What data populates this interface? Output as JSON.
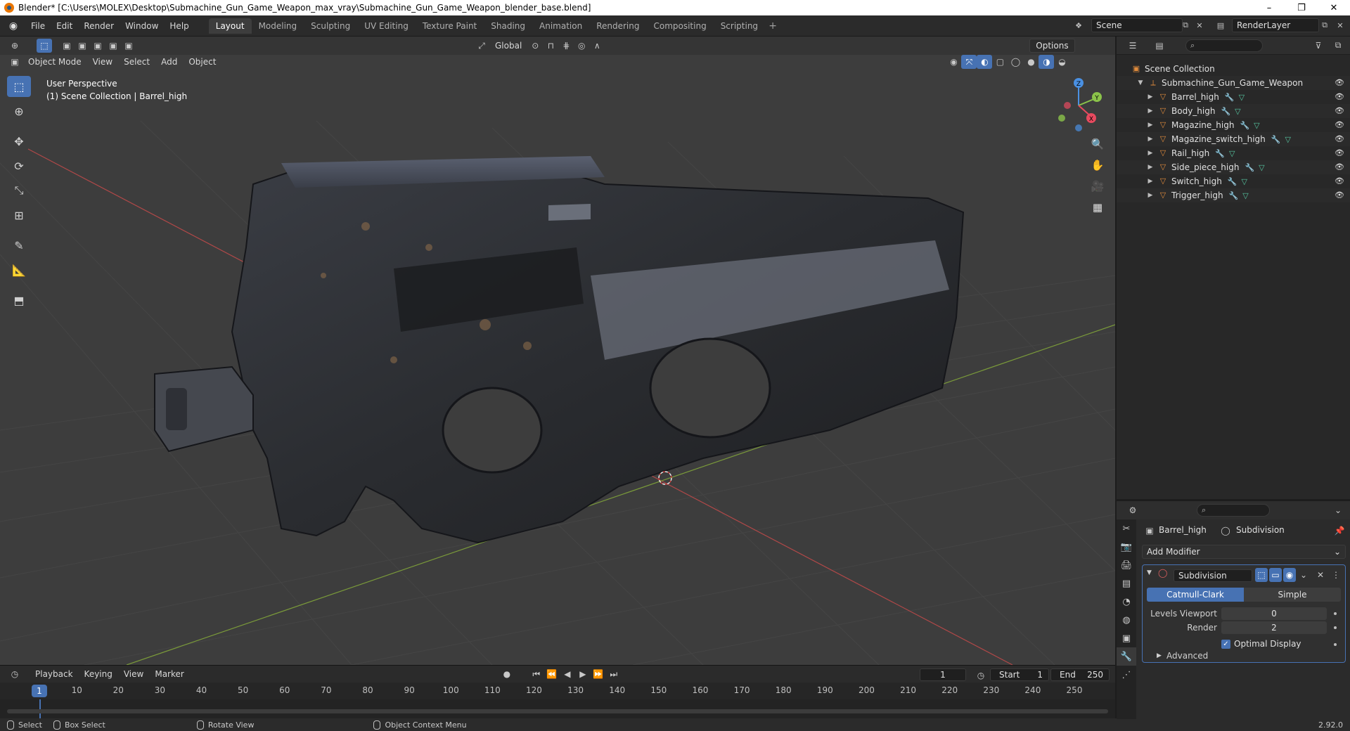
{
  "window": {
    "title": "Blender* [C:\\Users\\MOLEX\\Desktop\\Submachine_Gun_Game_Weapon_max_vray\\Submachine_Gun_Game_Weapon_blender_base.blend]",
    "minimize": "–",
    "maximize": "❐",
    "close": "✕"
  },
  "menu": [
    "File",
    "Edit",
    "Render",
    "Window",
    "Help"
  ],
  "workspaces": [
    "Layout",
    "Modeling",
    "Sculpting",
    "UV Editing",
    "Texture Paint",
    "Shading",
    "Animation",
    "Rendering",
    "Compositing",
    "Scripting"
  ],
  "active_workspace": "Layout",
  "scene_name": "Scene",
  "view_layer": "RenderLayer",
  "viewport": {
    "mode": "Object Mode",
    "menus": [
      "View",
      "Select",
      "Add",
      "Object"
    ],
    "transform_orientation": "Global",
    "options_label": "Options",
    "info_line1": "User Perspective",
    "info_line2": "(1) Scene Collection | Barrel_high",
    "gizmo_axes": [
      "Z",
      "Y",
      "X"
    ]
  },
  "timeline": {
    "menus": [
      "Playback",
      "Keying",
      "View",
      "Marker"
    ],
    "current_frame": "1",
    "start_label": "Start",
    "start": "1",
    "end_label": "End",
    "end": "250",
    "ruler": [
      "1",
      "10",
      "20",
      "30",
      "40",
      "50",
      "60",
      "70",
      "80",
      "90",
      "100",
      "110",
      "120",
      "130",
      "140",
      "150",
      "160",
      "170",
      "180",
      "190",
      "200",
      "210",
      "220",
      "230",
      "240",
      "250"
    ]
  },
  "statusbar": {
    "select": "Select",
    "box_select": "Box Select",
    "rotate_view": "Rotate View",
    "context_menu": "Object Context Menu",
    "version": "2.92.0"
  },
  "outliner": {
    "root": "Scene Collection",
    "collection": "Submachine_Gun_Game_Weapon",
    "objects": [
      "Barrel_high",
      "Body_high",
      "Magazine_high",
      "Magazine_switch_high",
      "Rail_high",
      "Side_piece_high",
      "Switch_high",
      "Trigger_high"
    ]
  },
  "properties": {
    "object": "Barrel_high",
    "modifier_crumb": "Subdivision",
    "add_modifier": "Add Modifier",
    "modifier_name": "Subdivision",
    "mode_a": "Catmull-Clark",
    "mode_b": "Simple",
    "levels_viewport_label": "Levels Viewport",
    "levels_viewport": "0",
    "render_label": "Render",
    "render": "2",
    "optimal_display": "Optimal Display",
    "advanced": "Advanced"
  },
  "colors": {
    "accent": "#4772b3",
    "x_axis": "#e84a5f",
    "y_axis": "#8bc34a",
    "z_axis": "#4a90e2",
    "mesh_icon": "#e08b3c"
  }
}
